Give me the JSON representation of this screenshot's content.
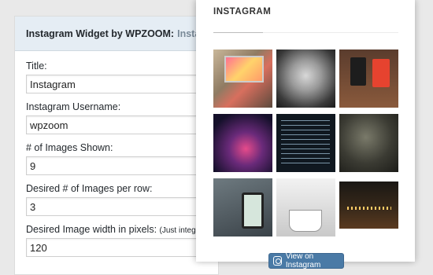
{
  "widget": {
    "header_title": "Instagram Widget by WPZOOM:",
    "header_subtitle": "Instagram",
    "fields": [
      {
        "label": "Title:",
        "value": "Instagram"
      },
      {
        "label": "Instagram Username:",
        "value": "wpzoom"
      },
      {
        "label": "# of Images Shown:",
        "value": "9"
      },
      {
        "label": "Desired # of Images per row:",
        "value": "3"
      },
      {
        "label": "Desired Image width in pixels:",
        "hint": "(Just integer)",
        "value": "120"
      }
    ]
  },
  "preview": {
    "title": "INSTAGRAM",
    "view_button_label": "View on Instagram",
    "photos": [
      {
        "icon": "laptop-photo"
      },
      {
        "icon": "selfie-photo"
      },
      {
        "icon": "phones-photo"
      },
      {
        "icon": "city-night-photo"
      },
      {
        "icon": "code-terminal-photo"
      },
      {
        "icon": "car-driver-photo"
      },
      {
        "icon": "smartphone-desk-photo"
      },
      {
        "icon": "coffee-cup-photo"
      },
      {
        "icon": "night-lights-photo"
      }
    ]
  }
}
